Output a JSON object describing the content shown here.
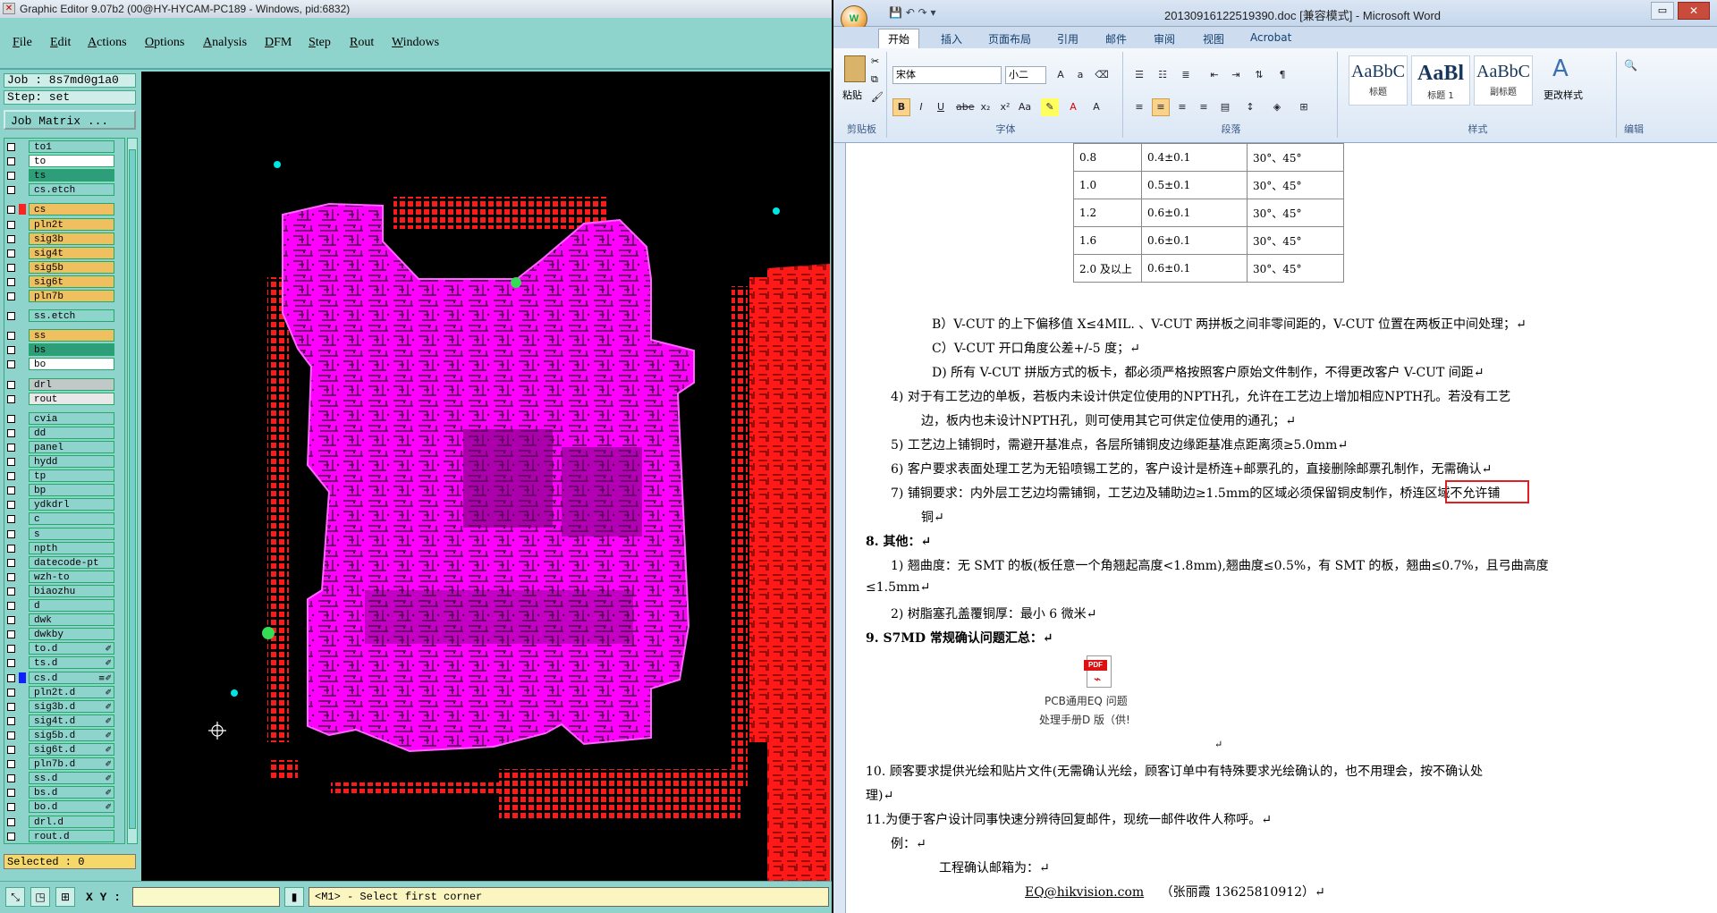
{
  "graphic_editor": {
    "window_title": "Graphic Editor 9.07b2 (00@HY-HYCAM-PC189 - Windows, pid:6832)",
    "menu": [
      "File",
      "Edit",
      "Actions",
      "Options",
      "Analysis",
      "DFM",
      "Step",
      "Rout",
      "Windows"
    ],
    "job_label": "Job : 8s7md0g1a0",
    "step_label": "Step: set",
    "job_matrix_button": "Job Matrix ...",
    "layers": [
      {
        "name": "to1",
        "color": "#8fd3cd",
        "swatch": "",
        "flag": ""
      },
      {
        "name": "to",
        "color": "#ffffff",
        "swatch": "",
        "flag": ""
      },
      {
        "name": "ts",
        "color": "#2e9e7a",
        "swatch": "",
        "flag": ""
      },
      {
        "name": "cs.etch",
        "color": "#8fd3cd",
        "swatch": "",
        "flag": ""
      },
      {
        "name": "cs",
        "color": "#f0c060",
        "swatch": "#ff2020",
        "flag": ""
      },
      {
        "name": "pln2t",
        "color": "#f0c060",
        "swatch": "",
        "flag": ""
      },
      {
        "name": "sig3b",
        "color": "#f0c060",
        "swatch": "",
        "flag": ""
      },
      {
        "name": "sig4t",
        "color": "#f0c060",
        "swatch": "",
        "flag": ""
      },
      {
        "name": "sig5b",
        "color": "#f0c060",
        "swatch": "",
        "flag": ""
      },
      {
        "name": "sig6t",
        "color": "#f0c060",
        "swatch": "",
        "flag": ""
      },
      {
        "name": "pln7b",
        "color": "#f0c060",
        "swatch": "",
        "flag": ""
      },
      {
        "name": "ss.etch",
        "color": "#8fd3cd",
        "swatch": "",
        "flag": ""
      },
      {
        "name": "ss",
        "color": "#f0c060",
        "swatch": "",
        "flag": ""
      },
      {
        "name": "bs",
        "color": "#2e9e7a",
        "swatch": "",
        "flag": ""
      },
      {
        "name": "bo",
        "color": "#ffffff",
        "swatch": "",
        "flag": ""
      },
      {
        "name": "drl",
        "color": "#c0c8c8",
        "swatch": "",
        "flag": ""
      },
      {
        "name": "rout",
        "color": "#e8e8e8",
        "swatch": "",
        "flag": ""
      },
      {
        "name": "cvia",
        "color": "#8fd3cd",
        "swatch": "",
        "flag": ""
      },
      {
        "name": "dd",
        "color": "#8fd3cd",
        "swatch": "",
        "flag": ""
      },
      {
        "name": "panel",
        "color": "#8fd3cd",
        "swatch": "",
        "flag": ""
      },
      {
        "name": "hydd",
        "color": "#8fd3cd",
        "swatch": "",
        "flag": ""
      },
      {
        "name": "tp",
        "color": "#8fd3cd",
        "swatch": "",
        "flag": ""
      },
      {
        "name": "bp",
        "color": "#8fd3cd",
        "swatch": "",
        "flag": ""
      },
      {
        "name": "ydkdrl",
        "color": "#8fd3cd",
        "swatch": "",
        "flag": ""
      },
      {
        "name": "c",
        "color": "#8fd3cd",
        "swatch": "",
        "flag": ""
      },
      {
        "name": "s",
        "color": "#8fd3cd",
        "swatch": "",
        "flag": ""
      },
      {
        "name": "npth",
        "color": "#8fd3cd",
        "swatch": "",
        "flag": ""
      },
      {
        "name": "datecode-pt",
        "color": "#8fd3cd",
        "swatch": "",
        "flag": ""
      },
      {
        "name": "wzh-to",
        "color": "#8fd3cd",
        "swatch": "",
        "flag": ""
      },
      {
        "name": "biaozhu",
        "color": "#8fd3cd",
        "swatch": "",
        "flag": ""
      },
      {
        "name": "d",
        "color": "#8fd3cd",
        "swatch": "",
        "flag": ""
      },
      {
        "name": "dwk",
        "color": "#8fd3cd",
        "swatch": "",
        "flag": ""
      },
      {
        "name": "dwkby",
        "color": "#8fd3cd",
        "swatch": "",
        "flag": ""
      },
      {
        "name": "to.d",
        "color": "#8fd3cd",
        "swatch": "",
        "flag": "✐"
      },
      {
        "name": "ts.d",
        "color": "#8fd3cd",
        "swatch": "",
        "flag": "✐"
      },
      {
        "name": "cs.d",
        "color": "#8fd3cd",
        "swatch": "#1020ff",
        "flag": "≡✐"
      },
      {
        "name": "pln2t.d",
        "color": "#8fd3cd",
        "swatch": "",
        "flag": "✐"
      },
      {
        "name": "sig3b.d",
        "color": "#8fd3cd",
        "swatch": "",
        "flag": "✐"
      },
      {
        "name": "sig4t.d",
        "color": "#8fd3cd",
        "swatch": "",
        "flag": "✐"
      },
      {
        "name": "sig5b.d",
        "color": "#8fd3cd",
        "swatch": "",
        "flag": "✐"
      },
      {
        "name": "sig6t.d",
        "color": "#8fd3cd",
        "swatch": "",
        "flag": "✐"
      },
      {
        "name": "pln7b.d",
        "color": "#8fd3cd",
        "swatch": "",
        "flag": "✐"
      },
      {
        "name": "ss.d",
        "color": "#8fd3cd",
        "swatch": "",
        "flag": "✐"
      },
      {
        "name": "bs.d",
        "color": "#8fd3cd",
        "swatch": "",
        "flag": "✐"
      },
      {
        "name": "bo.d",
        "color": "#8fd3cd",
        "swatch": "",
        "flag": "✐"
      },
      {
        "name": "drl.d",
        "color": "#8fd3cd",
        "swatch": "",
        "flag": ""
      },
      {
        "name": "rout.d",
        "color": "#8fd3cd",
        "swatch": "",
        "flag": ""
      }
    ],
    "selected_label": "Selected : 0",
    "xy_label": "X Y :",
    "xy_value": "",
    "status_message": "<M1> - Select first corner",
    "colors": {
      "magenta": "#ff00ff",
      "red": "#ff1a1a",
      "highlight_bg": "#f5d86a"
    }
  },
  "word": {
    "title": "20130916122519390.doc [兼容模式] - Microsoft Word",
    "tabs": [
      "开始",
      "插入",
      "页面布局",
      "引用",
      "邮件",
      "审阅",
      "视图",
      "Acrobat"
    ],
    "active_tab": "开始",
    "ribbon": {
      "paste_label": "粘贴",
      "clipboard_group": "剪贴板",
      "font_name": "宋体",
      "font_size": "小二",
      "font_group": "字体",
      "paragraph_group": "段落",
      "styles_group": "样式",
      "change_styles": "更改样式",
      "edit_group": "编辑",
      "styles": [
        {
          "preview": "AaBbC",
          "name": "标题"
        },
        {
          "preview": "AaBl",
          "name": "标题 1"
        },
        {
          "preview": "AaBbC",
          "name": "副标题"
        }
      ]
    },
    "table_rows": [
      [
        "0.8",
        "0.4±0.1",
        "30°、45°"
      ],
      [
        "1.0",
        "0.5±0.1",
        "30°、45°"
      ],
      [
        "1.2",
        "0.6±0.1",
        "30°、45°"
      ],
      [
        "1.6",
        "0.6±0.1",
        "30°、45°"
      ],
      [
        "2.0 及以上",
        "0.6±0.1",
        "30°、45°"
      ]
    ],
    "lines": [
      "B）V-CUT 的上下偏移值 X≤4MIL. 、V-CUT 两拼板之间非零间距的，V-CUT  位置在两板正中间处理；↵",
      "C）V-CUT 开口角度公差+/-5 度；↵",
      "D) 所有 V-CUT 拼版方式的板卡，都必须严格按照客户原始文件制作，不得更改客户 V-CUT 间距↵",
      "4)  对于有工艺边的单板，若板内未设计供定位使用的NPTH孔，允许在工艺边上增加相应NPTH孔。若没有工艺",
      "边，板内也未设计NPTH孔，则可使用其它可供定位使用的通孔；↵",
      "5)  工艺边上铺铜时，需避开基准点，各层所铺铜皮边缘距基准点距离须≥5.0mm↵",
      "6)  客户要求表面处理工艺为无铅喷锡工艺的，客户设计是桥连+邮票孔的，直接删除邮票孔制作，无需确认↵",
      "7)  铺铜要求：内外层工艺边均需铺铜，工艺边及辅助边≥1.5mm的区域必须保留铜皮制作，桥连区域不允许铺",
      "铜↵",
      "8.    其他：↵",
      "1) 翘曲度：无 SMT 的板(板任意一个角翘起高度<1.8mm),翘曲度≤0.5%，有 SMT 的板，翘曲≤0.7%，且弓曲高度",
      "≤1.5mm↵",
      "2) 树脂塞孔盖覆铜厚：最小 6 微米↵",
      "9.    S7MD 常规确认问题汇总：↵",
      "↵",
      "10.  顾客要求提供光绘和贴片文件(无需确认光绘，顾客订单中有特殊要求光绘确认的，也不用理会，按不确认处",
      "理)↵",
      "11.为便于客户设计同事快速分辨待回复邮件，现统一邮件收件人称呼。↵",
      "例：↵",
      "工程确认邮箱为：↵",
      "（张丽霞 13625810912）↵"
    ],
    "email": "EQ@hikvision.com",
    "attachment_caption_1": "PCB通用EQ 问题",
    "attachment_caption_2": "处理手册D 版（供!",
    "pdf_badge": "PDF"
  }
}
